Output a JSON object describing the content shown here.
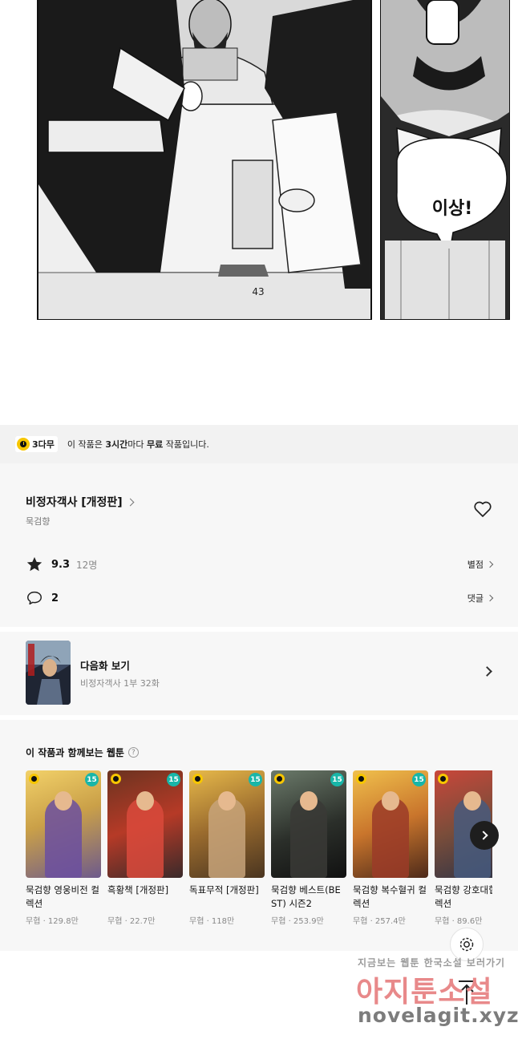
{
  "comic": {
    "page_number": "43",
    "speech_bubble": "이상!"
  },
  "free_bar": {
    "badge": "3다무",
    "text_prefix": "이 작품은 ",
    "text_bold_time": "3시간",
    "text_mid": "마다 ",
    "text_bold_free": "무료",
    "text_suffix": " 작품입니다."
  },
  "info": {
    "title": "비정자객사 [개정판]",
    "author": "묵검향",
    "rating": "9.3",
    "rating_count": "12명",
    "rating_link": "별점",
    "comments": "2",
    "comments_link": "댓글"
  },
  "next_episode": {
    "label": "다음화 보기",
    "subtitle": "비정자객사 1부 32화"
  },
  "recommended": {
    "title": "이 작품과 함께보는 웹툰",
    "help": "?",
    "items": [
      {
        "name": "묵검향 영웅비전 컬렉션",
        "meta": "무협 · 129.8만",
        "age": "15"
      },
      {
        "name": "흑황책 [개정판]",
        "meta": "무협 · 22.7만",
        "age": "15"
      },
      {
        "name": "독표무적 [개정판]",
        "meta": "무협 · 118만",
        "age": "15"
      },
      {
        "name": "묵검향 베스트(BEST) 시즌2",
        "meta": "무협 · 253.9만",
        "age": "15"
      },
      {
        "name": "묵검향 복수혈귀 컬렉션",
        "meta": "무협 · 257.4만",
        "age": "15"
      },
      {
        "name": "묵검향 강호대협 컬렉션",
        "meta": "무협 · 89.6만",
        "age": ""
      }
    ]
  },
  "watermark": {
    "line1": "지금보는 웹툰 한국소설 보러가기",
    "line2": "아지툰소설",
    "line3": "novelagit.xyz"
  },
  "colors": {
    "badge_yellow": "#f7c600",
    "age_badge": "#18b6a8",
    "panel_bg": "#f7f7f7",
    "bar_bg": "#f2f2f2"
  }
}
